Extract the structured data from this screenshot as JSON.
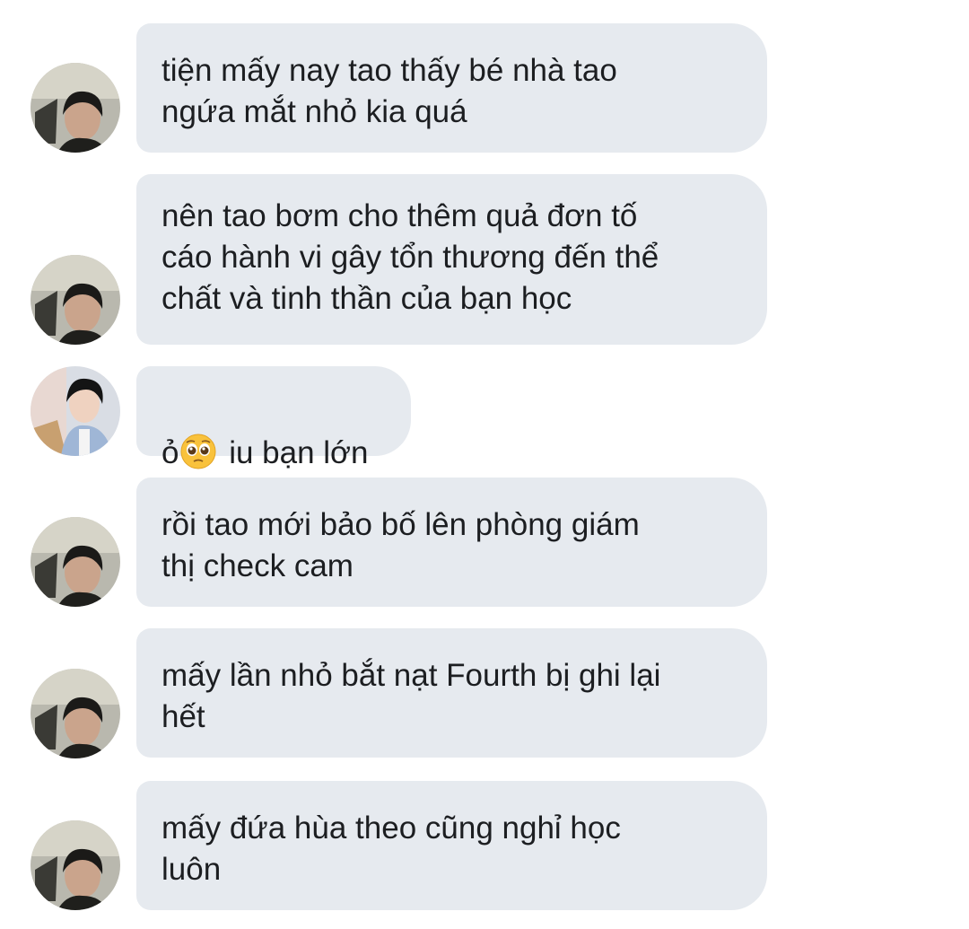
{
  "messages": [
    {
      "sender": "friend",
      "avatar": "dark-hair-guy-avatar",
      "text": "tiện mấy nay tao thấy bé nhà tao\nngứa mắt nhỏ kia quá"
    },
    {
      "sender": "friend",
      "avatar": "dark-hair-guy-avatar",
      "text": "nên tao bơm cho thêm quả đơn tố\ncáo hành vi gây tổn thương đến thể\nchất và tinh thần của bạn học"
    },
    {
      "sender": "other",
      "avatar": "blue-shirt-guy-avatar",
      "text_before": "ỏ",
      "emoji": "pleading-face-emoji",
      "text_after": " iu bạn lớn"
    },
    {
      "sender": "friend",
      "avatar": "dark-hair-guy-avatar",
      "text": "rồi tao mới bảo bố lên phòng giám\nthị check cam"
    },
    {
      "sender": "friend",
      "avatar": "dark-hair-guy-avatar",
      "text": "mấy lần nhỏ bắt nạt Fourth bị ghi lại\nhết"
    },
    {
      "sender": "friend",
      "avatar": "dark-hair-guy-avatar",
      "text": "mấy đứa hùa theo cũng nghỉ học\nluôn"
    }
  ],
  "colors": {
    "background": "#ffffff",
    "bubble": "#e6eaef",
    "text": "#1c1e21"
  }
}
